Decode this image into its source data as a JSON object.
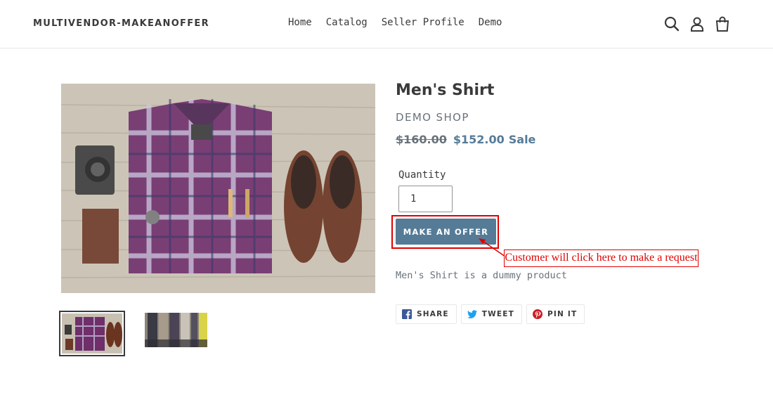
{
  "header": {
    "logo": "MULTIVENDOR-MAKEANOFFER",
    "nav": [
      "Home",
      "Catalog",
      "Seller Profile",
      "Demo"
    ],
    "icons": [
      "search-icon",
      "account-icon",
      "cart-icon"
    ]
  },
  "product": {
    "title": "Men's Shirt",
    "vendor": "DEMO SHOP",
    "compare_price": "$160.00",
    "price": "$152.00",
    "sale_label": "Sale",
    "quantity_label": "Quantity",
    "quantity_value": "1",
    "offer_button": "MAKE AN OFFER",
    "description": "Men's Shirt is a dummy product"
  },
  "annotation": {
    "callout": "Customer will click here to make a request"
  },
  "share": [
    {
      "icon": "facebook-icon",
      "label": "SHARE"
    },
    {
      "icon": "twitter-icon",
      "label": "TWEET"
    },
    {
      "icon": "pinterest-icon",
      "label": "PIN IT"
    }
  ],
  "colors": {
    "accent": "#557b97",
    "highlight": "#e00000",
    "text": "#3a3a3a",
    "muted": "#69727b"
  }
}
